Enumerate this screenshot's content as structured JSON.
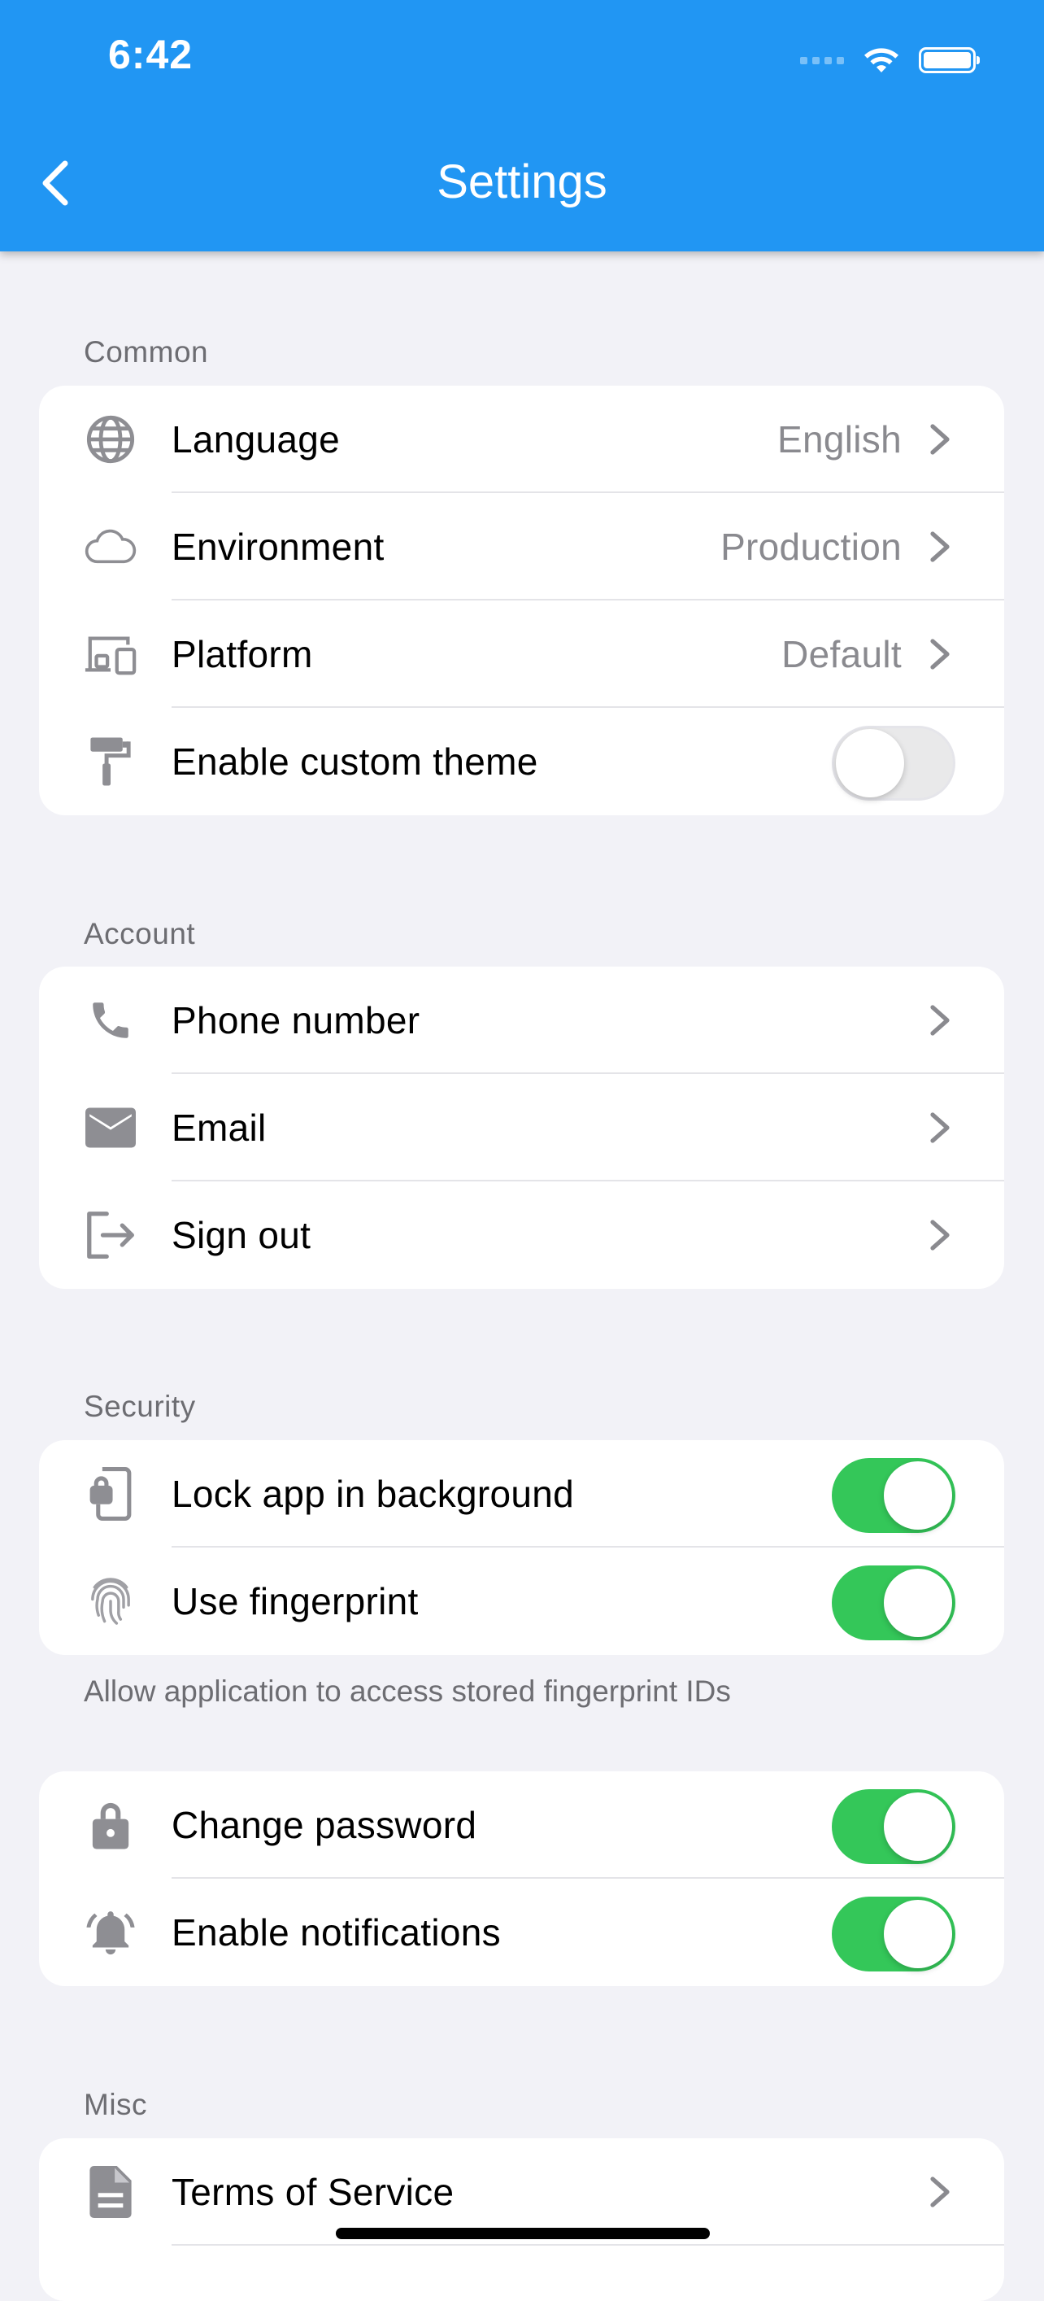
{
  "status_bar": {
    "time": "6:42"
  },
  "header": {
    "title": "Settings",
    "back_icon": "chevron-left-icon"
  },
  "colors": {
    "header": "#2196f3",
    "toggle_on": "#34c759",
    "background": "#f2f2f7"
  },
  "sections": {
    "common": {
      "label": "Common",
      "items": [
        {
          "label": "Language",
          "value": "English",
          "icon": "globe-icon"
        },
        {
          "label": "Environment",
          "value": "Production",
          "icon": "cloud-icon"
        },
        {
          "label": "Platform",
          "value": "Default",
          "icon": "devices-icon"
        },
        {
          "label": "Enable custom theme",
          "icon": "paint-roller-icon",
          "toggle": false
        }
      ]
    },
    "account": {
      "label": "Account",
      "items": [
        {
          "label": "Phone number",
          "icon": "phone-icon"
        },
        {
          "label": "Email",
          "icon": "mail-icon"
        },
        {
          "label": "Sign out",
          "icon": "logout-icon"
        }
      ]
    },
    "security": {
      "label": "Security",
      "items": [
        {
          "label": "Lock app in background",
          "icon": "phone-lock-icon",
          "toggle": true
        },
        {
          "label": "Use fingerprint",
          "icon": "fingerprint-icon",
          "toggle": true
        }
      ],
      "footnote": "Allow application to access stored fingerprint IDs"
    },
    "security2": {
      "items": [
        {
          "label": "Change password",
          "icon": "lock-icon",
          "toggle": true
        },
        {
          "label": "Enable notifications",
          "icon": "bell-icon",
          "toggle": true
        }
      ]
    },
    "misc": {
      "label": "Misc",
      "items": [
        {
          "label": "Terms of Service",
          "icon": "document-icon"
        }
      ]
    }
  }
}
